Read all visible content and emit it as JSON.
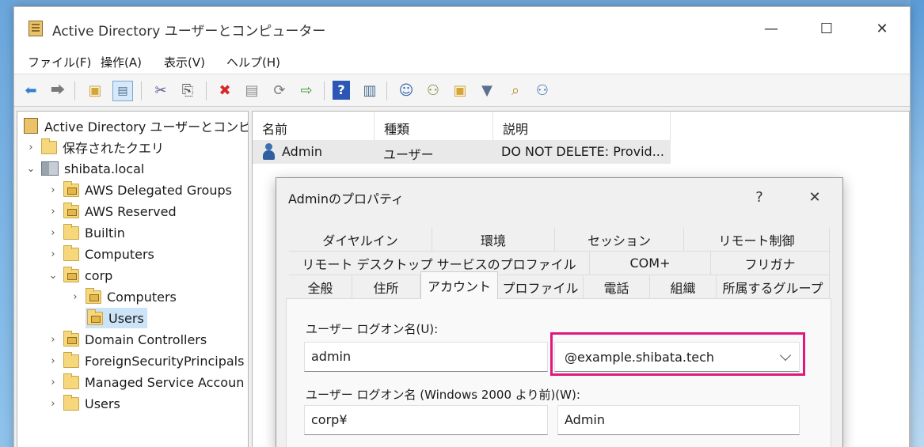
{
  "window": {
    "title": "Active Directory ユーザーとコンピューター",
    "minimize": "—",
    "maximize": "☐",
    "close": "✕"
  },
  "menu": [
    "ファイル(F)",
    "操作(A)",
    "表示(V)",
    "ヘルプ(H)"
  ],
  "toolbar_icons": [
    "back-arrow-icon",
    "forward-arrow-icon",
    "up-folder-icon",
    "show-console-tree-icon",
    "cut-icon",
    "paste-icon",
    "delete-icon",
    "properties-icon",
    "refresh-icon",
    "export-list-icon",
    "help-icon",
    "action-pane-icon",
    "new-user-icon",
    "new-group-icon",
    "new-ou-icon",
    "filter-icon",
    "find-icon",
    "add-to-group-icon"
  ],
  "tree": {
    "root": "Active Directory ユーザーとコンピューター",
    "saved_queries": "保存されたクエリ",
    "domain": "shibata.local",
    "items": [
      "AWS Delegated Groups",
      "AWS Reserved",
      "Builtin",
      "Computers",
      "corp"
    ],
    "corp_children": [
      "Computers",
      "Users"
    ],
    "items_after": [
      "Domain Controllers",
      "ForeignSecurityPrincipals",
      "Managed Service Accoun",
      "Users"
    ]
  },
  "list": {
    "headers": [
      "名前",
      "種類",
      "説明"
    ],
    "rows": [
      {
        "name": "Admin",
        "type": "ユーザー",
        "description": "DO NOT DELETE:  Provid..."
      }
    ]
  },
  "dialog": {
    "title": "Adminのプロパティ",
    "help": "?",
    "close": "✕",
    "tabs_row1": [
      "ダイヤルイン",
      "環境",
      "セッション",
      "リモート制御"
    ],
    "tabs_row2": [
      "リモート デスクトップ サービスのプロファイル",
      "COM+",
      "フリガナ"
    ],
    "tabs_row3": [
      "全般",
      "住所",
      "アカウント",
      "プロファイル",
      "電話",
      "組織",
      "所属するグループ"
    ],
    "logon_label": "ユーザー ログオン名(U):",
    "logon_value": "admin",
    "upn_suffix": "@example.shibata.tech",
    "legacy_label": "ユーザー ログオン名 (Windows 2000 より前)(W):",
    "legacy_domain": "corp¥",
    "legacy_name": "Admin"
  },
  "colors": {
    "highlight": "#e0187d",
    "accent": "#0078d4"
  }
}
